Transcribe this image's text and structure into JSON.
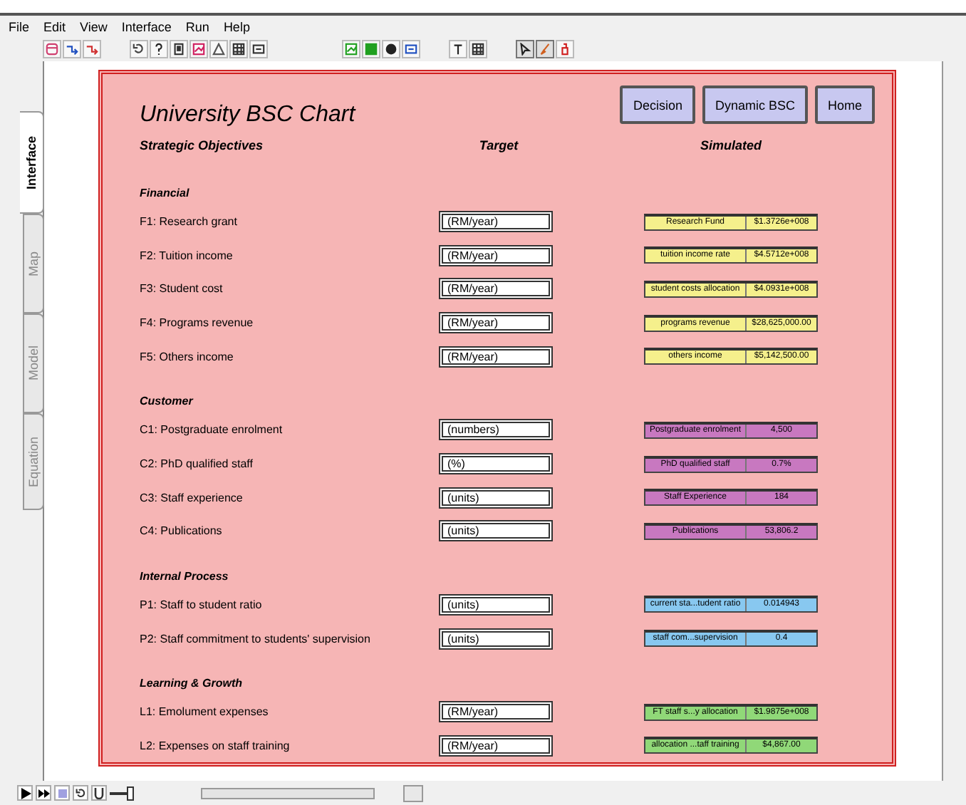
{
  "menu": [
    "File",
    "Edit",
    "View",
    "Interface",
    "Run",
    "Help"
  ],
  "side_tabs": [
    {
      "label": "Interface",
      "selected": true
    },
    {
      "label": "Map",
      "selected": false
    },
    {
      "label": "Model",
      "selected": false
    },
    {
      "label": "Equation",
      "selected": false
    }
  ],
  "panel": {
    "title": "University BSC Chart",
    "buttons": [
      "Decision",
      "Dynamic BSC",
      "Home"
    ],
    "headings": [
      "Strategic Objectives",
      "Target",
      "Simulated"
    ],
    "sections": [
      {
        "title": "Financial",
        "color": "#f5f08c",
        "rows": [
          {
            "label": "F1: Research grant",
            "target": "(RM/year)",
            "sim_name": "Research Fund",
            "sim_value": "$1.3726e+008"
          },
          {
            "label": "F2: Tuition income",
            "target": "(RM/year)",
            "sim_name": "tuition income rate",
            "sim_value": "$4.5712e+008"
          },
          {
            "label": "F3: Student cost",
            "target": "(RM/year)",
            "sim_name": "student costs allocation",
            "sim_value": "$4.0931e+008"
          },
          {
            "label": "F4: Programs revenue",
            "target": "(RM/year)",
            "sim_name": "programs revenue",
            "sim_value": "$28,625,000.00"
          },
          {
            "label": "F5: Others income",
            "target": "(RM/year)",
            "sim_name": "others income",
            "sim_value": "$5,142,500.00"
          }
        ]
      },
      {
        "title": "Customer",
        "color": "#c878c0",
        "rows": [
          {
            "label": "C1: Postgraduate enrolment",
            "target": "(numbers)",
            "sim_name": "Postgraduate enrolment",
            "sim_value": "4,500"
          },
          {
            "label": "C2: PhD qualified staff",
            "target": "(%)",
            "sim_name": "PhD qualified staff",
            "sim_value": "0.7%"
          },
          {
            "label": "C3: Staff experience",
            "target": "(units)",
            "sim_name": "Staff Experience",
            "sim_value": "184"
          },
          {
            "label": "C4: Publications",
            "target": "(units)",
            "sim_name": "Publications",
            "sim_value": "53,806.2"
          }
        ]
      },
      {
        "title": "Internal Process",
        "color": "#88c8f0",
        "rows": [
          {
            "label": "P1: Staff to student ratio",
            "target": "(units)",
            "sim_name": "current sta...tudent ratio",
            "sim_value": "0.014943"
          },
          {
            "label": "P2: Staff commitment to students' supervision",
            "target": "(units)",
            "sim_name": "staff com...supervision",
            "sim_value": "0.4"
          }
        ]
      },
      {
        "title": "Learning & Growth",
        "color": "#90d878",
        "rows": [
          {
            "label": "L1: Emolument expenses",
            "target": "(RM/year)",
            "sim_name": "FT staff s...y allocation",
            "sim_value": "$1.9875e+008"
          },
          {
            "label": "L2: Expenses on staff training",
            "target": "(RM/year)",
            "sim_name": "allocation ...taff training",
            "sim_value": "$4,867.00"
          }
        ]
      }
    ]
  },
  "run_controls": {
    "speed": {
      "level": 0.25
    }
  }
}
